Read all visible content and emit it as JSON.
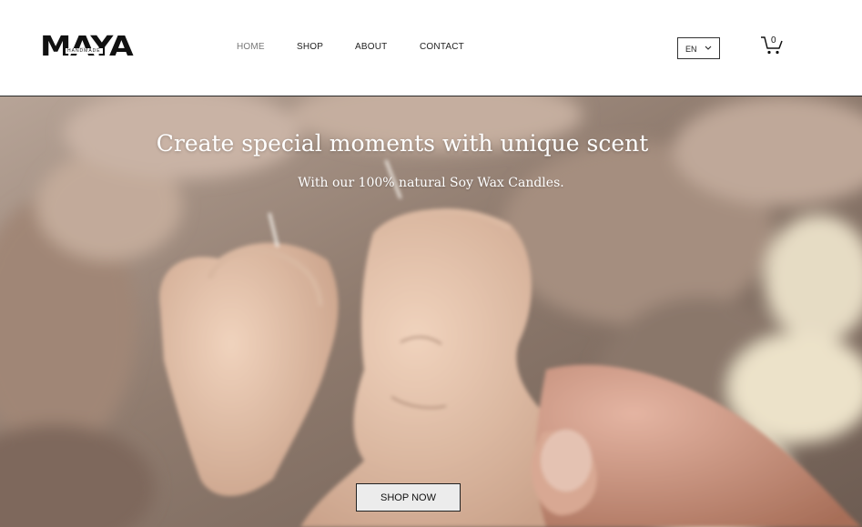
{
  "brand": {
    "logo_text": "MAYA",
    "logo_subtext": "HANDMADE"
  },
  "nav": {
    "items": [
      {
        "label": "HOME",
        "active": true
      },
      {
        "label": "SHOP"
      },
      {
        "label": "ABOUT"
      },
      {
        "label": "CONTACT"
      }
    ]
  },
  "language": {
    "selected": "EN"
  },
  "cart": {
    "count": "0"
  },
  "hero": {
    "title": "Create special moments with unique scent",
    "subtitle": "With our 100% natural Soy Wax Candles.",
    "cta_label": "SHOP NOW"
  },
  "colors": {
    "text": "#111111",
    "active_nav": "#777777",
    "button_bg": "#ececec"
  },
  "icons": {
    "language_dropdown": "chevron-down-icon",
    "cart": "cart-icon"
  }
}
